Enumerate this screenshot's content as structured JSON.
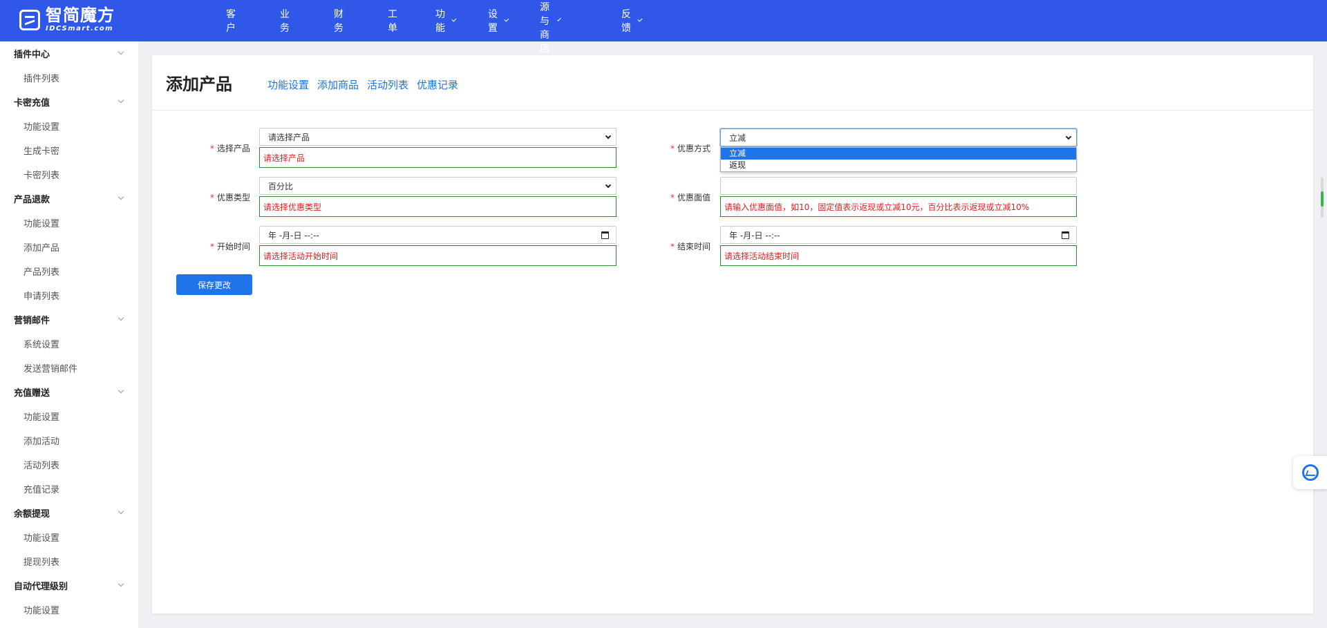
{
  "header": {
    "logo_cn": "智简魔方",
    "logo_en": "IDCSmart.com",
    "nav": [
      {
        "label": "客户",
        "dropdown": false
      },
      {
        "label": "业务",
        "dropdown": false
      },
      {
        "label": "财务",
        "dropdown": false
      },
      {
        "label": "工单",
        "dropdown": false
      },
      {
        "label": "功能",
        "dropdown": true
      },
      {
        "label": "设置",
        "dropdown": true
      },
      {
        "label": "资源与商店",
        "dropdown": true
      },
      {
        "label": "反馈",
        "dropdown": true
      }
    ]
  },
  "sidebar": [
    {
      "group": "插件中心",
      "items": [
        "插件列表"
      ]
    },
    {
      "group": "卡密充值",
      "items": [
        "功能设置",
        "生成卡密",
        "卡密列表"
      ]
    },
    {
      "group": "产品退款",
      "items": [
        "功能设置",
        "添加产品",
        "产品列表",
        "申请列表"
      ]
    },
    {
      "group": "营销邮件",
      "items": [
        "系统设置",
        "发送营销邮件"
      ]
    },
    {
      "group": "充值赠送",
      "items": [
        "功能设置",
        "添加活动",
        "活动列表",
        "充值记录"
      ]
    },
    {
      "group": "余额提现",
      "items": [
        "功能设置",
        "提现列表"
      ]
    },
    {
      "group": "自动代理级别",
      "items": [
        "功能设置"
      ]
    }
  ],
  "page": {
    "title": "添加产品",
    "tabs": [
      "功能设置",
      "添加商品",
      "活动列表",
      "优惠记录"
    ]
  },
  "form": {
    "product_label": "选择产品",
    "product_value": "请选择产品",
    "product_error": "请选择产品",
    "method_label": "优惠方式",
    "method_value": "立减",
    "method_options": [
      "立减",
      "返现"
    ],
    "type_label": "优惠类型",
    "type_value": "百分比",
    "type_error": "请选择优惠类型",
    "amount_label": "优惠面值",
    "amount_value": "",
    "amount_error": "请输入优惠面值，如10，固定值表示返现或立减10元，百分比表示返现或立减10%",
    "start_label": "开始时间",
    "start_placeholder": "年 -月-日 --:--",
    "start_error": "请选择活动开始时间",
    "end_label": "结束时间",
    "end_placeholder": "年 -月-日 --:--",
    "end_error": "请选择活动结束时间",
    "save_label": "保存更改"
  },
  "colors": {
    "topbar": "#3058e8",
    "accent": "#1e74e8",
    "error_text": "#e31c1c",
    "error_border": "#2b8a2b"
  }
}
